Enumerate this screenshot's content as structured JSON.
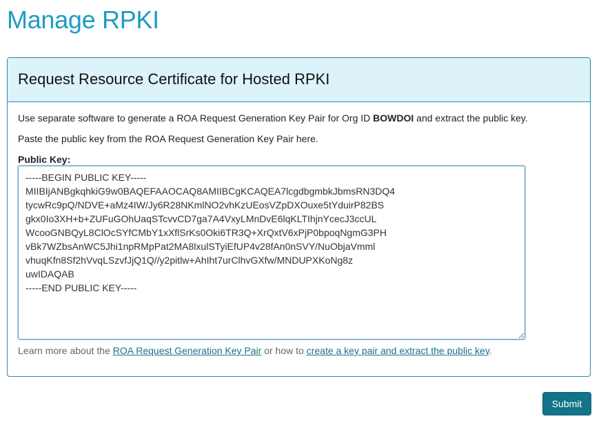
{
  "page": {
    "title": "Manage RPKI"
  },
  "panel": {
    "title": "Request Resource Certificate for Hosted RPKI",
    "instruction_prefix": "Use separate software to generate a ROA Request Generation Key Pair for Org ID ",
    "org_id": "BOWDOI",
    "instruction_suffix": " and extract the public key.",
    "paste_instruction": "Paste the public key from the ROA Request Generation Key Pair here.",
    "field_label": "Public Key:",
    "public_key_value": "-----BEGIN PUBLIC KEY-----\nMIIBIjANBgkqhkiG9w0BAQEFAAOCAQ8AMIIBCgKCAQEA7lcgdbgmbkJbmsRN3DQ4\ntycwRc9pQ/NDVE+aMz4IW/Jy6R28NKmlNO2vhKzUEosVZpDXOuxe5tYduirP82BS\ngkx0Io3XH+b+ZUFuGOhUaqSTcvvCD7ga7A4VxyLMnDvE6lqKLTIhjnYcecJ3ccUL\nWcooGNBQyL8ClOcSYfCMbY1xXflSrKs0Oki6TR3Q+XrQxtV6xPjP0bpoqNgmG3PH\nvBk7WZbsAnWC5Jhi1npRMpPat2MA8lxulSTyiEfUP4v28fAn0nSVY/NuObjaVmml\nvhuqKfn8Sf2hVvqLSzvfJjQ1Q//y2pitlw+AhIht7urClhvGXfw/MNDUPXKoNg8z\nuwIDAQAB\n-----END PUBLIC KEY-----",
    "help_prefix": "Learn more about the ",
    "help_link1": "ROA Request Generation Key Pair",
    "help_middle": " or how to ",
    "help_link2": "create a key pair and extract the public key",
    "help_suffix": "."
  },
  "actions": {
    "submit_label": "Submit"
  },
  "colors": {
    "title": "#1f9bc3",
    "panel_header_bg": "#dcf3fa",
    "panel_border": "#2a8aa5",
    "link": "#1a6f8f",
    "submit_bg": "#127489"
  }
}
